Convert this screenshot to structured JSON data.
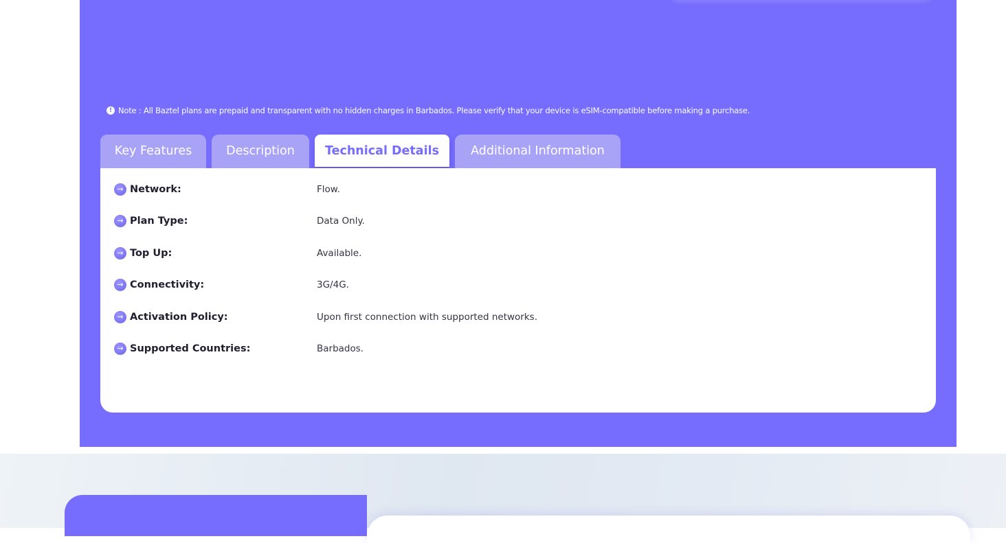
{
  "note": {
    "icon": "info-icon",
    "text": "Note : All Baztel plans are prepaid and transparent with no hidden charges in Barbados. Please verify that your device is eSIM-compatible before making a purchase."
  },
  "tabs": [
    {
      "label": "Key Features",
      "active": false
    },
    {
      "label": "Description",
      "active": false
    },
    {
      "label": "Technical Details",
      "active": true
    },
    {
      "label": "Additional Information",
      "active": false
    }
  ],
  "technical_details": [
    {
      "label": "Network:",
      "value": "Flow."
    },
    {
      "label": "Plan Type:",
      "value": "Data Only."
    },
    {
      "label": "Top Up:",
      "value": "Available."
    },
    {
      "label": "Connectivity:",
      "value": "3G/4G."
    },
    {
      "label": "Activation Policy:",
      "value": "Upon first connection with supported networks."
    },
    {
      "label": "Supported Countries:",
      "value": "Barbados."
    }
  ],
  "bullet_icon": "arrow-right-circle-icon",
  "colors": {
    "accent": "#766cfd",
    "tab_inactive": "#a8a3f7",
    "card": "#ffffff",
    "text_dark": "#1f1f2e"
  }
}
